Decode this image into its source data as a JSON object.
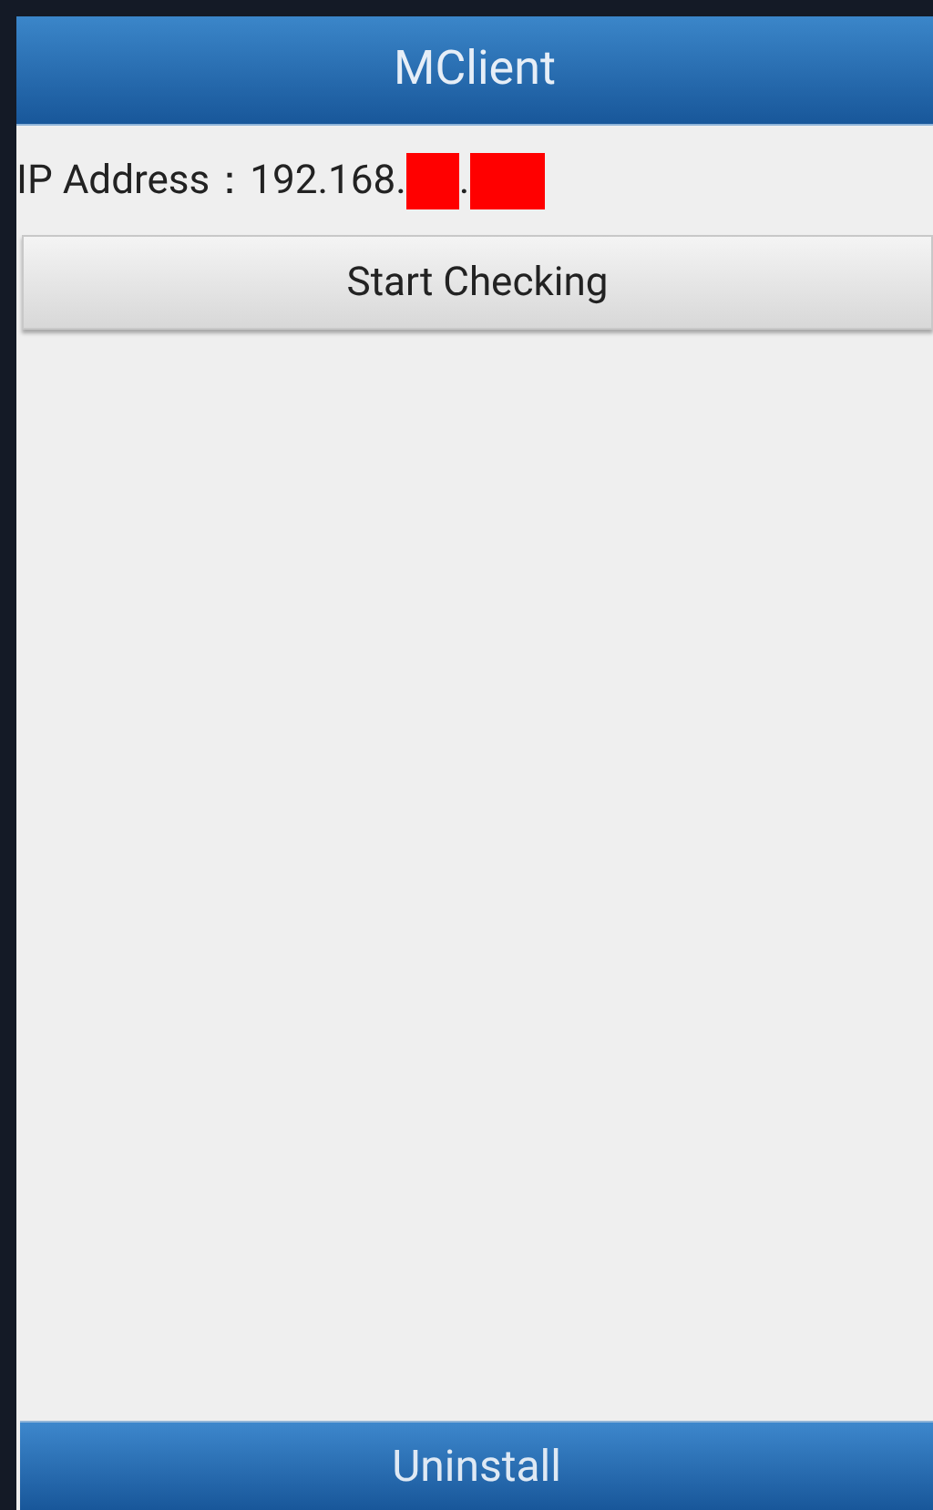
{
  "title": "MClient",
  "ip": {
    "label": "IP Address：",
    "prefix": "192.168.",
    "separator": ".",
    "redacted": true
  },
  "check_button": "Start Checking",
  "bottom_button": "Uninstall"
}
